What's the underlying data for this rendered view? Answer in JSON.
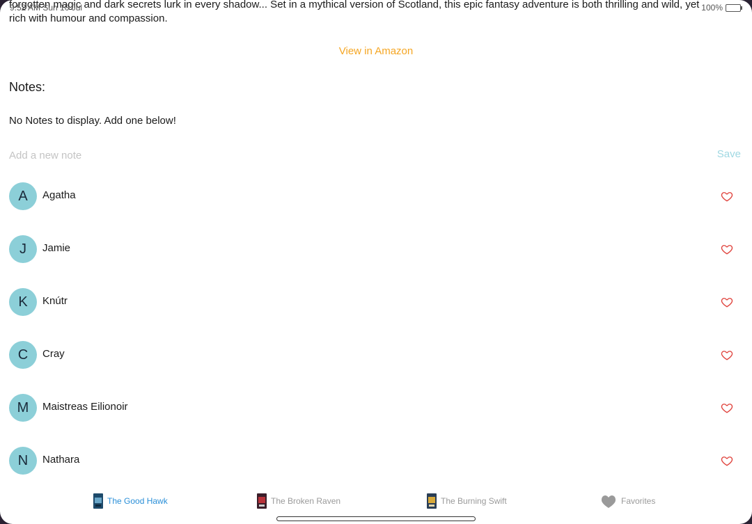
{
  "statusbar": {
    "time": "9:52 AM",
    "date": "Sun 10 Jul",
    "battery": "100%"
  },
  "book": {
    "description_line1": "forgotten magic and dark secrets lurk in every shadow... Set in a mythical version of Scotland, this epic fantasy adventure is both thrilling and wild, yet",
    "description_line2": "rich with humour and compassion.",
    "amazon_link": "View in Amazon"
  },
  "notes": {
    "title": "Notes:",
    "empty_message": "No Notes to display. Add one below!",
    "input_placeholder": "Add a new note",
    "input_value": "",
    "save_label": "Save"
  },
  "characters": [
    {
      "initial": "A",
      "name": "Agatha"
    },
    {
      "initial": "J",
      "name": "Jamie"
    },
    {
      "initial": "K",
      "name": "Knútr"
    },
    {
      "initial": "C",
      "name": "Cray"
    },
    {
      "initial": "M",
      "name": "Maistreas Eilionoir"
    },
    {
      "initial": "N",
      "name": "Nathara"
    }
  ],
  "tabs": [
    {
      "label": "The Good Hawk",
      "active": true,
      "icon": "book-cover-icon"
    },
    {
      "label": "The Broken Raven",
      "active": false,
      "icon": "book-cover-icon"
    },
    {
      "label": "The Burning Swift",
      "active": false,
      "icon": "book-cover-icon"
    },
    {
      "label": "Favorites",
      "active": false,
      "icon": "heart-icon"
    }
  ],
  "colors": {
    "accent_amazon": "#f5a623",
    "avatar_bg": "#8ccfd8",
    "heart": "#e0443e",
    "tab_active": "#2a8fd8",
    "tab_inactive": "#9a9a9a"
  }
}
